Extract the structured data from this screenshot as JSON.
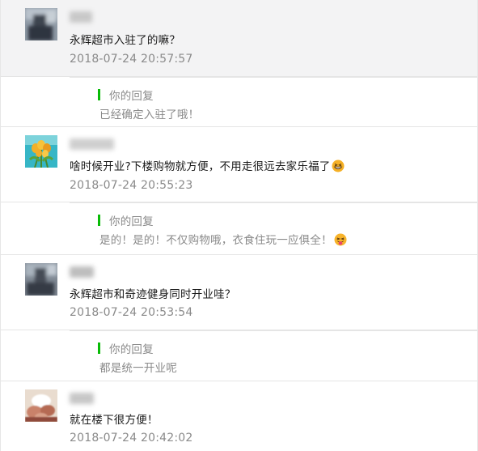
{
  "comments": [
    {
      "text": "永辉超市入驻了的嘛？",
      "time": "2018-07-24 20:57:57",
      "reply_label": "你的回复",
      "reply": "已经确定入驻了哦！",
      "avatar_icon": "blurred-person-avatar",
      "highlighted": true
    },
    {
      "text": "啥时候开业?下楼购物就方便，不用走很远去家乐福了",
      "emoji": "grinning-face-emoji",
      "time": "2018-07-24 20:55:23",
      "reply_label": "你的回复",
      "reply": "是的！是的！不仅购物哦，衣食住玩一应俱全！",
      "reply_emoji": "tongue-out-face-emoji",
      "avatar_icon": "tulips-avatar"
    },
    {
      "text": "永辉超市和奇迹健身同时开业哇？",
      "time": "2018-07-24 20:53:54",
      "reply_label": "你的回复",
      "reply": "都是统一开业呢",
      "avatar_icon": "blurred-person-avatar"
    },
    {
      "text": "就在楼下很方便！",
      "time": "2018-07-24 20:42:02",
      "avatar_icon": "hands-photo-avatar"
    }
  ],
  "colors": {
    "reply_bar": "#09bb07",
    "meta": "#8a8a8a",
    "highlight_bg": "#f3f3f4"
  }
}
